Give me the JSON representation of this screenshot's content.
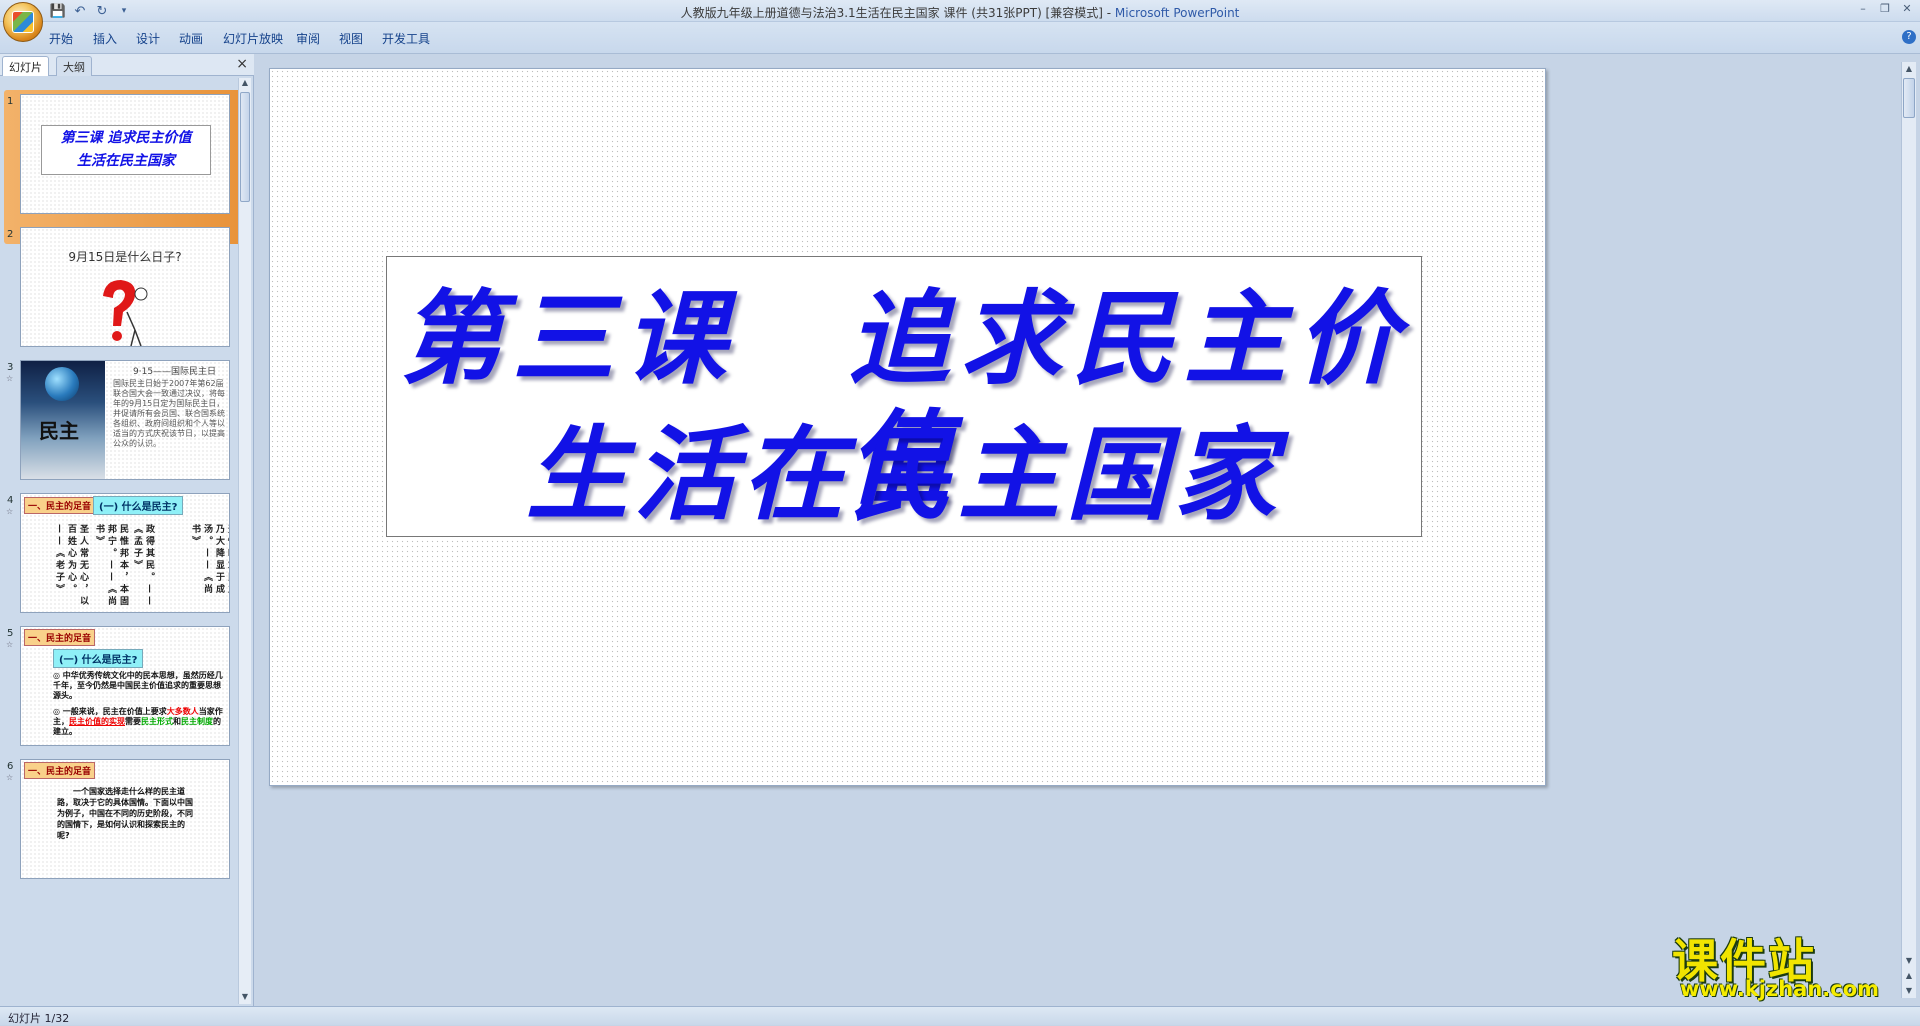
{
  "window": {
    "title_main": "人教版九年级上册道德与法治3.1生活在民主国家 课件 (共31张PPT) [兼容模式] - ",
    "title_app": "Microsoft PowerPoint"
  },
  "ribbon": {
    "tabs": [
      "开始",
      "插入",
      "设计",
      "动画",
      "幻灯片放映",
      "审阅",
      "视图",
      "开发工具"
    ]
  },
  "pane": {
    "tab_slides": "幻灯片",
    "tab_outline": "大纲",
    "close": "×"
  },
  "thumbs": {
    "nums": [
      "1",
      "2",
      "3",
      "4",
      "5",
      "6"
    ],
    "note": "☆",
    "s1": {
      "line1": "第三课 追求民主价值",
      "line2": "生活在民主国家"
    },
    "s2": {
      "question": "9月15日是什么日子?"
    },
    "s3": {
      "char": "民主",
      "title": "9·15——国际民主日",
      "body": "国际民主日始于2007年第62届联合国大会一致通过决议，将每年的9月15日定为国际民主日，并促请所有会员国、联合国系统各组织、政府间组织和个人等以适当的方式庆祝该节日，以提高公众的认识。"
    },
    "s4": {
      "tag": "一、民主的足音",
      "sub": "(一) 什么是民主?",
      "cols": [
        "天惟时求民主，乃大降显于成汤。——《尚书》",
        "政得其民。——《孟子》",
        "民惟邦本，本固邦宁。——《尚书》",
        "圣人常无心，以百姓心为心。——《老子》"
      ]
    },
    "s5": {
      "tag": "一、民主的足音",
      "sub": "(一) 什么是民主?",
      "p1": "◎ 中华优秀传统文化中的民本思想，虽然历经几千年，至今仍然是中国民主价值追求的重要思想源头。",
      "p2a": "◎ 一般来说，民主在价值上要求",
      "p2b": "大多数人",
      "p2c": "当家作主，",
      "p2d": "民主价值的实现",
      "p2e": "需要",
      "p2f": "民主形式",
      "p2g": "和",
      "p2h": "民主制度",
      "p2i": "的建立。"
    },
    "s6": {
      "tag": "一、民主的足音",
      "body": "一个国家选择走什么样的民主道路，取决于它的具体国情。下面以中国为例子，中国在不同的历史阶段，不同的国情下，是如何认识和探索民主的呢?"
    }
  },
  "slide": {
    "line1": "第三课　追求民主价值",
    "line2": "生活在民主国家"
  },
  "status": {
    "text": "幻灯片 1/32"
  },
  "watermark": {
    "big": "课件站",
    "url": "www.kjzhan.com"
  },
  "colors": {
    "title_blue": "#1212e6",
    "selection_orange": "#f0a252",
    "watermark_yellow": "#f1e400"
  }
}
